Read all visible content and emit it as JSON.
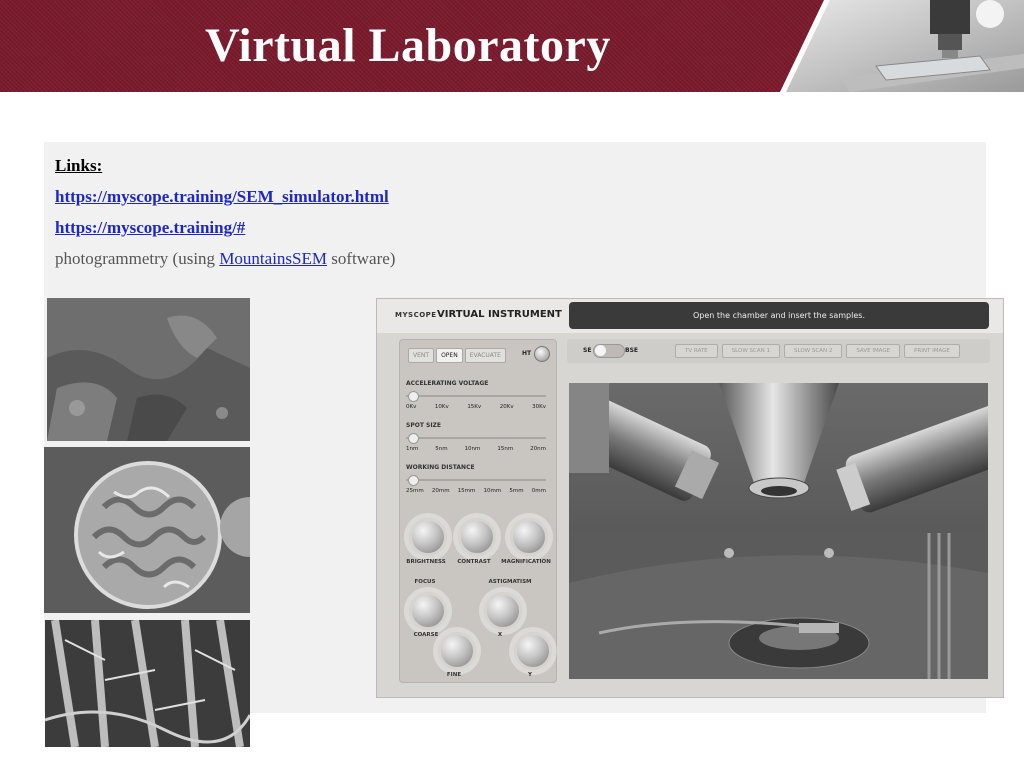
{
  "header": {
    "title": "Virtual Laboratory"
  },
  "links": {
    "heading": "Links:",
    "link1": "https://myscope.training/SEM_simulator.html",
    "link2": "https://myscope.training/#",
    "note_prefix": "photogrammetry (using ",
    "note_link": "MountainsSEM",
    "note_suffix": " software)"
  },
  "instrument": {
    "logo": "MYSCOPE",
    "title": "VIRTUAL INSTRUMENT",
    "message": "Open the chamber and insert the samples.",
    "chamber_buttons": [
      "VENT",
      "OPEN",
      "EVACUATE"
    ],
    "ht_label": "HT",
    "accelerating_voltage": {
      "label": "ACCELERATING VOLTAGE",
      "ticks": [
        "0Kv",
        "10Kv",
        "15Kv",
        "20Kv",
        "30Kv"
      ]
    },
    "spot_size": {
      "label": "SPOT SIZE",
      "ticks": [
        "1nm",
        "5nm",
        "10nm",
        "15nm",
        "20nm"
      ]
    },
    "working_distance": {
      "label": "WORKING DISTANCE",
      "ticks": [
        "25mm",
        "20mm",
        "15mm",
        "10mm",
        "5mm",
        "0mm"
      ]
    },
    "knobs": {
      "brightness": "BRIGHTNESS",
      "contrast": "CONTRAST",
      "magnification": "MAGNIFICATION",
      "focus": "FOCUS",
      "astigmatism": "ASTIGMATISM",
      "coarse": "COARSE",
      "fine": "FINE",
      "x": "X",
      "y": "Y"
    },
    "detector": {
      "se": "SE",
      "bse": "BSE"
    },
    "scan_buttons": [
      "TV RATE",
      "SLOW SCAN 1",
      "SLOW SCAN 2",
      "SAVE IMAGE",
      "PRINT IMAGE"
    ]
  },
  "colors": {
    "header_bg": "#7a1a2c",
    "link": "#1d27c9",
    "panel_bg": "#f1f1f1"
  }
}
